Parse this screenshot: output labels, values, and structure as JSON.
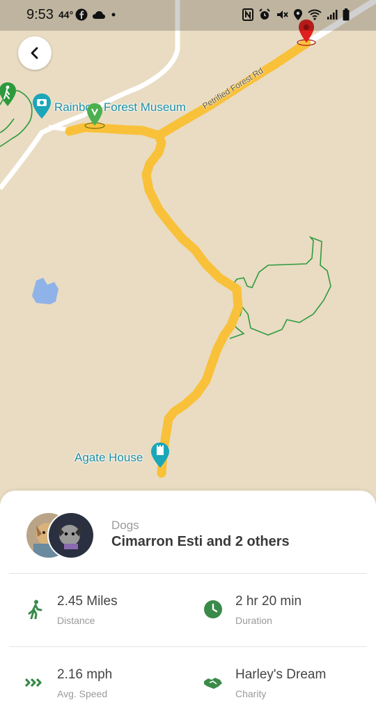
{
  "status_bar": {
    "time": "9:53",
    "temperature": "44°",
    "icons_left": [
      "facebook-icon",
      "cloud-icon",
      "dot-icon"
    ],
    "icons_right": [
      "nfc-icon",
      "alarm-icon",
      "mute-icon",
      "location-icon",
      "wifi-icon",
      "signal-icon",
      "battery-icon"
    ]
  },
  "map": {
    "poi_museum": "Rainbow Forest Museum",
    "poi_agate": "Agate House",
    "road_label": "Petrified Forest Rd",
    "colors": {
      "land": "#e9dcc2",
      "route": "#f9c13a",
      "trail": "#2e9a3e",
      "road": "#ffffff",
      "water": "#8fb2e8",
      "start_pin": "#4caf50",
      "end_pin": "#e02020",
      "poi": "#1ba6b9"
    }
  },
  "summary": {
    "dogs_label": "Dogs",
    "dogs_names": "Cimarron Esti and 2 others",
    "stats": {
      "distance": {
        "value": "2.45 Miles",
        "caption": "Distance",
        "icon": "walking-icon"
      },
      "duration": {
        "value": "2 hr 20 min",
        "caption": "Duration",
        "icon": "clock-icon"
      },
      "speed": {
        "value": "2.16 mph",
        "caption": "Avg. Speed",
        "icon": "chevrons-icon"
      },
      "charity": {
        "value": "Harley's Dream",
        "caption": "Charity",
        "icon": "handshake-icon"
      }
    },
    "accent": "#3a8a4a"
  }
}
